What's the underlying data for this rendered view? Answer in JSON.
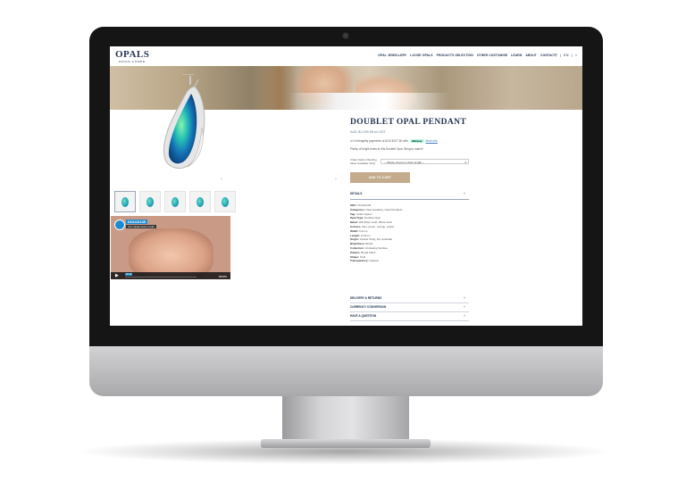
{
  "brand": {
    "logo_main": "OPALS",
    "logo_sub": "DOWN UNDER"
  },
  "nav": {
    "items": [
      "OPAL JEWELLERY",
      "LOOSE OPALS",
      "PRODUCTS SELECTION",
      "OTHER CUSTOMISE",
      "LEARN",
      "ABOUT",
      "CONTACT"
    ],
    "icons": [
      "search-icon",
      "account-icon",
      "cart-icon"
    ],
    "search_glyph": "⚲",
    "sep": "|",
    "currency": "EN",
    "cart_glyph": "⌂"
  },
  "product": {
    "title": "DOUBLET OPAL PENDANT",
    "price": "AUD $1,299.95 ex GST",
    "afterpay_text": "or 4 fortnightly payments of AUD $107.50 with",
    "afterpay_badge": "afterpay",
    "afterpay_more": "More info",
    "description": "Plenty of bright tones in this Doublet Opal. Bling to match!",
    "chain_label": "Chain Option (Sterling Silver Available Only)",
    "chain_select": "-- Please choose a chain length --",
    "chain_caret": "▾",
    "add_to_cart": "ADD TO CART"
  },
  "gallery": {
    "prev": "‹",
    "next": "›",
    "thumb_count": 5
  },
  "video": {
    "title": "DOU10135",
    "subtitle": "from Opals Down Under",
    "time": "00:48",
    "play": "▶",
    "brand": "vimeo"
  },
  "details": {
    "heading": "DETAILS",
    "chevron": "˅",
    "rows": [
      {
        "label": "SKU:",
        "value": "DOU10135"
      },
      {
        "label": "Categories:",
        "value": "Opal Jewellery, Opal Pendants"
      },
      {
        "label": "Tag:",
        "value": "Chain Option"
      },
      {
        "label": "Opal Type:",
        "value": "Doublet Opal"
      },
      {
        "label": "Metal:",
        "value": "18k White Gold, White Gold"
      },
      {
        "label": "Colours:",
        "value": "blue, green, orange, yellow"
      },
      {
        "label": "Width:",
        "value": "6.2mm"
      },
      {
        "label": "Length:",
        "value": "11.5mm"
      },
      {
        "label": "Origin:",
        "value": "Coober Pedy, SA, Australia"
      },
      {
        "label": "Brightness:",
        "value": "Bright"
      },
      {
        "label": "Collection:",
        "value": "Undulating Surface"
      },
      {
        "label": "Pattern:",
        "value": "Broad Flash"
      },
      {
        "label": "Shape:",
        "value": "Oval"
      },
      {
        "label": "Transparency:",
        "value": "Opaque"
      }
    ]
  },
  "accordions": [
    {
      "label": "DELIVERY & RETURNS"
    },
    {
      "label": "CURRENCY CONVERSION"
    },
    {
      "label": "HAVE A QUESTION"
    }
  ]
}
